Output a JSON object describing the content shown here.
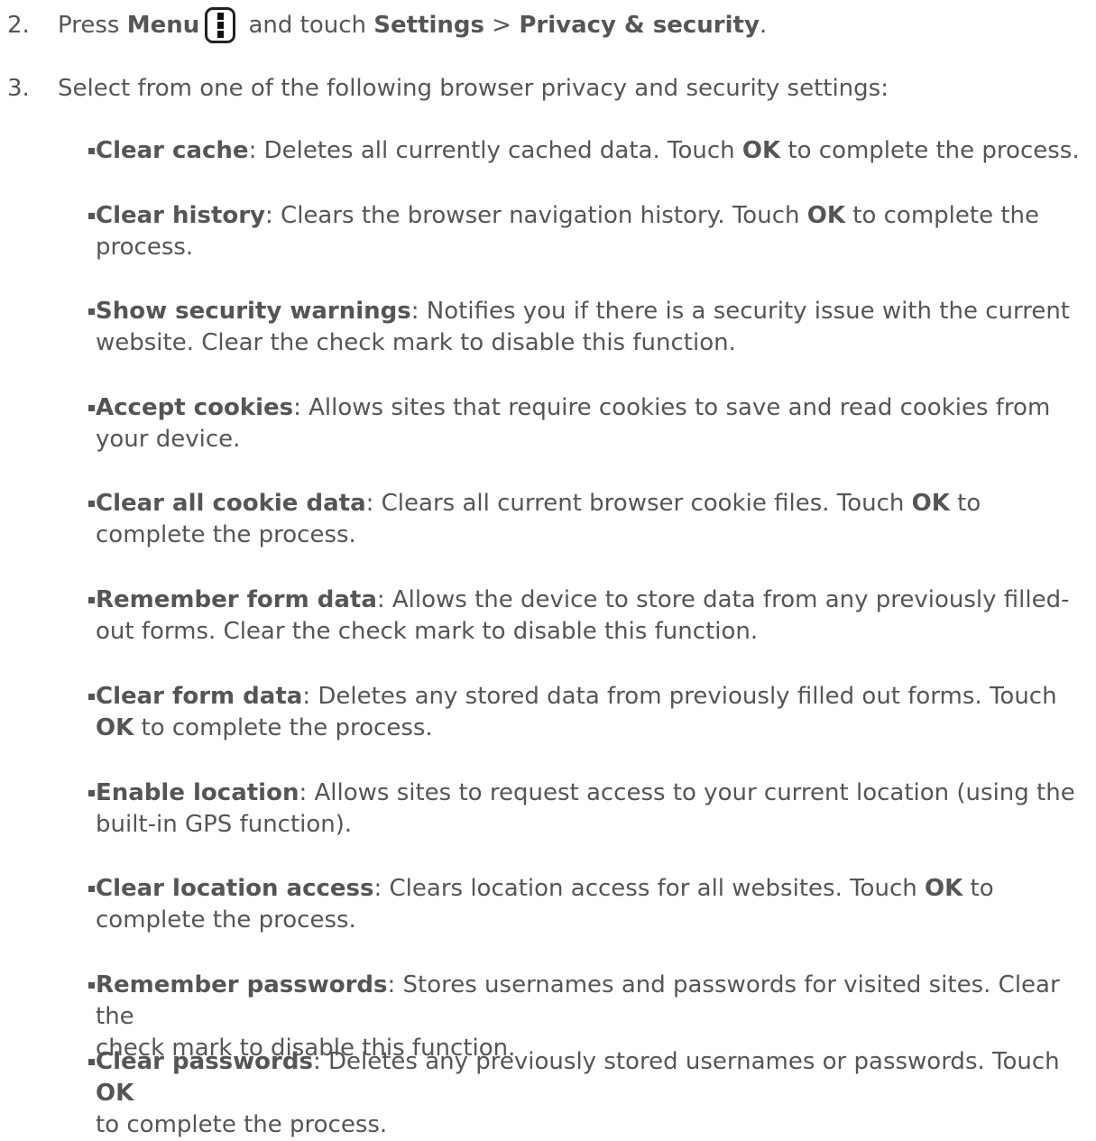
{
  "step2": {
    "number": "2.",
    "text_before": "Press ",
    "menu_label": "Menu",
    "menu_icon": "menu-key-icon",
    "text_middle": " and touch ",
    "settings_label": "Settings",
    "separator": " > ",
    "privacy_label": "Privacy & security",
    "end": "."
  },
  "step3": {
    "number": "3.",
    "text": "Select from one of the following browser privacy and security settings:"
  },
  "settings": [
    {
      "term": "Clear cache",
      "desc_line1": ": Deletes all currently cached data. Touch ",
      "ok": "OK",
      "desc_line1_end": " to complete the process.",
      "desc_line2": ""
    },
    {
      "term": "Clear history",
      "desc_line1": ": Clears the browser navigation history. Touch ",
      "ok": "OK",
      "desc_line1_end": " to complete the",
      "desc_line2": "process."
    },
    {
      "term": "Show security warnings",
      "desc_line1": ": Notifies you if there is a security issue with the current",
      "ok": "",
      "desc_line1_end": "",
      "desc_line2": "website. Clear the check mark to disable this function."
    },
    {
      "term": "Accept cookies",
      "desc_line1": ": Allows sites that require cookies to save and read cookies from",
      "ok": "",
      "desc_line1_end": "",
      "desc_line2": "your device."
    },
    {
      "term": "Clear all cookie data",
      "desc_line1": ": Clears all current browser cookie files. Touch ",
      "ok": "OK",
      "desc_line1_end": " to",
      "desc_line2": "complete the process."
    },
    {
      "term": "Remember form data",
      "desc_line1": ": Allows the device to store data from any previously filled-",
      "ok": "",
      "desc_line1_end": "",
      "desc_line2": "out forms. Clear the check mark to disable this function."
    },
    {
      "term": "Clear form data",
      "desc_line1": ": Deletes any stored data from previously filled out forms. Touch",
      "ok": "",
      "desc_line1_end": "",
      "desc_line2_ok": "OK",
      "desc_line2": " to complete the process."
    },
    {
      "term": "Enable location",
      "desc_line1": ": Allows sites to request access to your current location (using the",
      "ok": "",
      "desc_line1_end": "",
      "desc_line2": "built-in GPS function)."
    },
    {
      "term": "Clear location access",
      "desc_line1": ": Clears location access for all websites. Touch ",
      "ok": "OK",
      "desc_line1_end": " to",
      "desc_line2": "complete the process."
    },
    {
      "term": "Remember passwords",
      "desc_line1": ": Stores usernames and passwords for visited sites. Clear the",
      "ok": "",
      "desc_line1_end": "",
      "desc_line2": "check mark to disable this function."
    },
    {
      "term": "Clear passwords",
      "desc_line1": ": Deletes any previously stored usernames or passwords. Touch ",
      "ok": "OK",
      "desc_line1_end": "",
      "desc_line2": "to complete the process."
    }
  ]
}
